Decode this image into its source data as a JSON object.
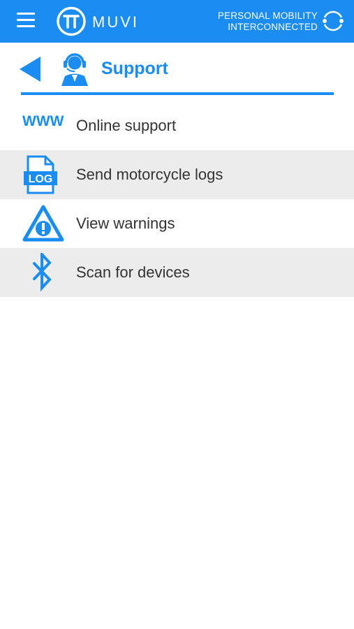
{
  "app_bar": {
    "brand": "MUVI",
    "tagline_line1": "PERSONAL MOBILITY",
    "tagline_line2": "INTERCONNECTED",
    "icons": [
      "hamburger-menu-icon",
      "muvi-logo",
      "sync-icon"
    ]
  },
  "page": {
    "title": "Support",
    "icons": [
      "back-arrow-icon",
      "support-agent-icon"
    ]
  },
  "menu": {
    "items": [
      {
        "label": "Online support",
        "icon": "www-icon",
        "icon_text": "WWW"
      },
      {
        "label": "Send motorcycle logs",
        "icon": "log-file-icon",
        "icon_text": "LOG"
      },
      {
        "label": "View warnings",
        "icon": "warning-icon"
      },
      {
        "label": "Scan for devices",
        "icon": "bluetooth-icon"
      }
    ]
  },
  "colors": {
    "accent": "#1a8cf2",
    "row_shade": "#ececec",
    "text": "#333333",
    "background": "#ffffff"
  }
}
